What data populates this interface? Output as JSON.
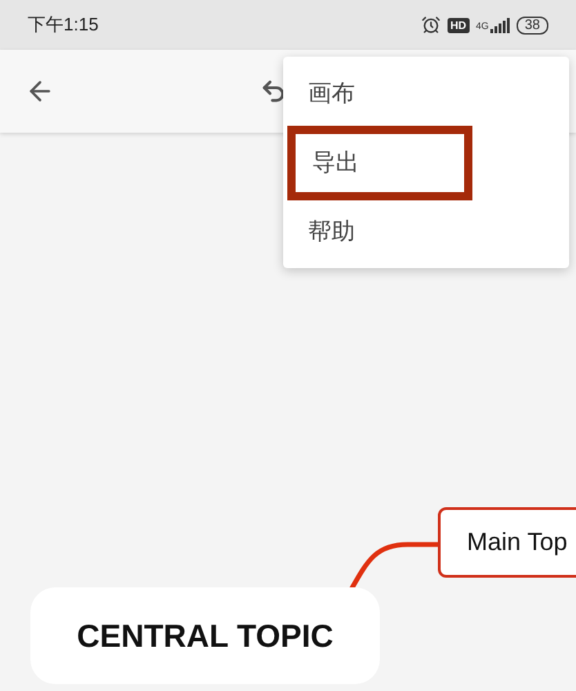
{
  "status_bar": {
    "time": "下午1:15",
    "hd": "HD",
    "network": "4G",
    "battery": "38"
  },
  "menu": {
    "items": [
      {
        "label": "画布",
        "highlighted": false
      },
      {
        "label": "导出",
        "highlighted": true
      },
      {
        "label": "帮助",
        "highlighted": false
      }
    ]
  },
  "canvas": {
    "central_topic": "CENTRAL TOPIC",
    "main_topic": "Main Top"
  }
}
